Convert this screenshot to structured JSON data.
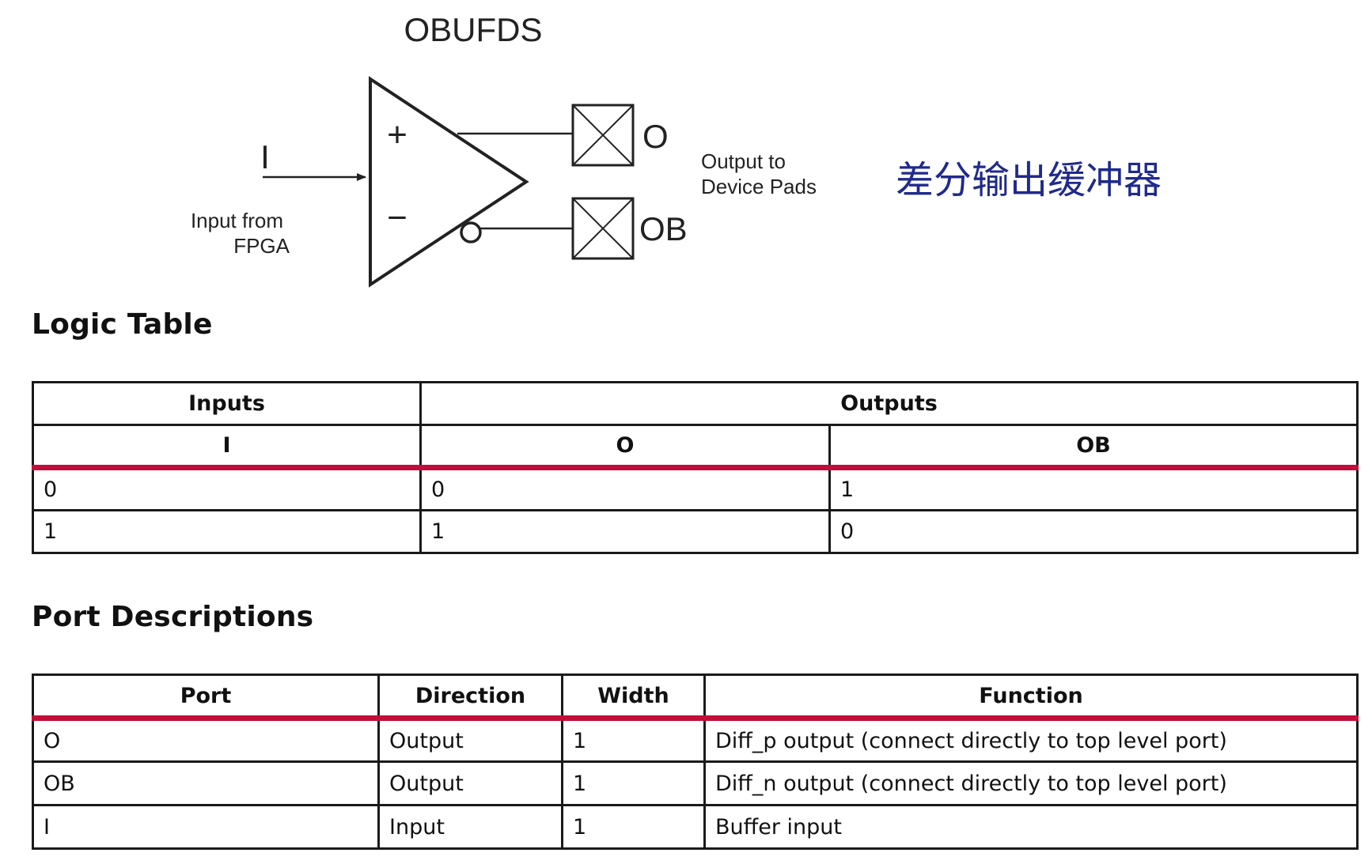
{
  "diagram": {
    "title": "OBUFDS",
    "input_port": "I",
    "plus_sign": "+",
    "minus_sign": "−",
    "output_o": "O",
    "output_ob": "OB",
    "input_label_line1": "Input from",
    "input_label_line2": "FPGA",
    "output_label_line1": "Output to",
    "output_label_line2": "Device Pads",
    "annotation": "差分输出缓冲器"
  },
  "colors": {
    "accent_rule": "#c20e3a",
    "annotation_text": "#1f2a8c",
    "border": "#1a1a1a"
  },
  "logic_table": {
    "heading": "Logic Table",
    "group_headers": [
      "Inputs",
      "Outputs"
    ],
    "columns": [
      "I",
      "O",
      "OB"
    ],
    "rows": [
      [
        "0",
        "0",
        "1"
      ],
      [
        "1",
        "1",
        "0"
      ]
    ]
  },
  "port_descriptions": {
    "heading": "Port Descriptions",
    "columns": [
      "Port",
      "Direction",
      "Width",
      "Function"
    ],
    "rows": [
      [
        "O",
        "Output",
        "1",
        "Diff_p output (connect directly to top level port)"
      ],
      [
        "OB",
        "Output",
        "1",
        "Diff_n output (connect directly to top level port)"
      ],
      [
        "I",
        "Input",
        "1",
        "Buffer input"
      ]
    ]
  }
}
